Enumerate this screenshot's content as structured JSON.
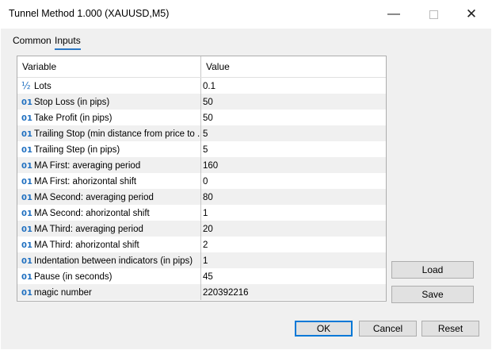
{
  "window": {
    "title": "Tunnel Method 1.000 (XAUUSD,M5)",
    "minimize_glyph": "—",
    "close_glyph": "✕"
  },
  "tabs": [
    {
      "label": "Common"
    },
    {
      "label": "Inputs"
    }
  ],
  "table": {
    "headers": {
      "variable": "Variable",
      "value": "Value"
    },
    "rows": [
      {
        "icon": "½",
        "icon_type": "fraction-icon",
        "variable": "Lots",
        "value": "0.1"
      },
      {
        "icon": "01",
        "icon_type": "integer-icon",
        "variable": "Stop Loss (in pips)",
        "value": "50"
      },
      {
        "icon": "01",
        "icon_type": "integer-icon",
        "variable": "Take Profit (in pips)",
        "value": "50"
      },
      {
        "icon": "01",
        "icon_type": "integer-icon",
        "variable": "Trailing Stop (min distance from price to ...",
        "value": "5"
      },
      {
        "icon": "01",
        "icon_type": "integer-icon",
        "variable": "Trailing Step (in pips)",
        "value": "5"
      },
      {
        "icon": "01",
        "icon_type": "integer-icon",
        "variable": "MA First: averaging period",
        "value": "160"
      },
      {
        "icon": "01",
        "icon_type": "integer-icon",
        "variable": "MA First: ahorizontal shift",
        "value": "0"
      },
      {
        "icon": "01",
        "icon_type": "integer-icon",
        "variable": "MA Second: averaging period",
        "value": "80"
      },
      {
        "icon": "01",
        "icon_type": "integer-icon",
        "variable": "MA Second: ahorizontal shift",
        "value": "1"
      },
      {
        "icon": "01",
        "icon_type": "integer-icon",
        "variable": "MA Third: averaging period",
        "value": "20"
      },
      {
        "icon": "01",
        "icon_type": "integer-icon",
        "variable": "MA Third: ahorizontal shift",
        "value": "2"
      },
      {
        "icon": "01",
        "icon_type": "integer-icon",
        "variable": "Indentation between indicators (in pips)",
        "value": "1"
      },
      {
        "icon": "01",
        "icon_type": "integer-icon",
        "variable": "Pause (in seconds)",
        "value": "45"
      },
      {
        "icon": "01",
        "icon_type": "integer-icon",
        "variable": "magic number",
        "value": "220392216"
      }
    ]
  },
  "side_buttons": {
    "load": "Load",
    "save": "Save"
  },
  "footer": {
    "ok": "OK",
    "cancel": "Cancel",
    "reset": "Reset"
  },
  "colors": {
    "accent": "#0078d7",
    "icon": "#1e6fc0",
    "tab_underline": "#2b78c5"
  }
}
